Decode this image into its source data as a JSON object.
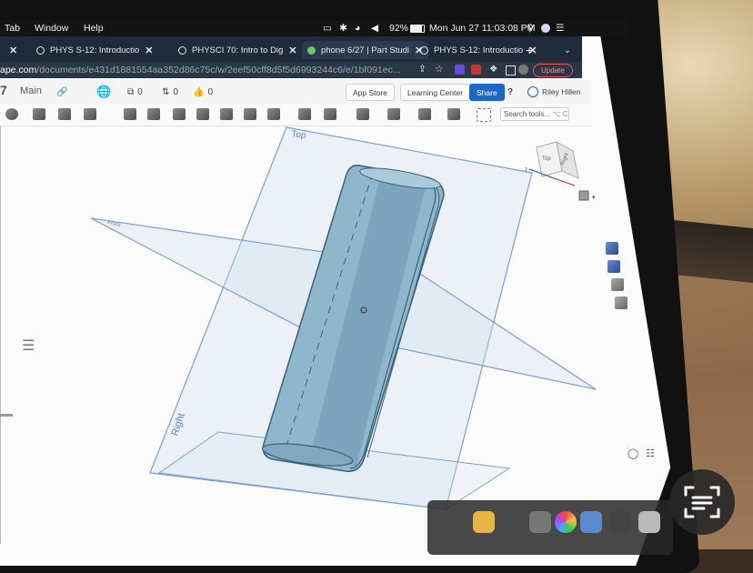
{
  "menubar": {
    "left_items": [
      "Tab",
      "Window",
      "Help"
    ],
    "battery": "92%",
    "datetime": "Mon Jun 27  11:03:08 PM"
  },
  "tabs": [
    {
      "label": "PHYS S-12: Introductio",
      "active": false
    },
    {
      "label": "PHYSCI 70: Intro to Dig",
      "active": false
    },
    {
      "label": "phone 6/27 | Part Studi",
      "active": true
    },
    {
      "label": "PHYS S-12: Introductio",
      "active": false
    }
  ],
  "new_tab_label": "+",
  "url": {
    "domain": "ape.com",
    "path": "/documents/e431d1881554aa352d86c75c/w/2eef50cff8d5f5d6993244c6/e/1bf091ec..."
  },
  "update_label": "Update",
  "document": {
    "number": "7",
    "branch": "Main",
    "counter_a": "0",
    "counter_b": "0",
    "counter_c": "0"
  },
  "header_buttons": {
    "app_store": "App Store",
    "learning_center": "Learning Center",
    "share": "Share",
    "user_name": "Riley Hillen",
    "help": "?"
  },
  "search_tools": "Search tools...",
  "search_shortcut": "⌥ C",
  "view_cube": {
    "top": "Top",
    "right": "Right"
  },
  "plane_labels": {
    "top": "Top",
    "right": "Right",
    "front": "Front"
  },
  "colors": {
    "accent": "#1c67c7",
    "model_fill": "#8fb7cc",
    "model_edge": "#3e5f78",
    "plane_line": "#7d9fc8",
    "plane_fill": "#cfe0ef"
  }
}
